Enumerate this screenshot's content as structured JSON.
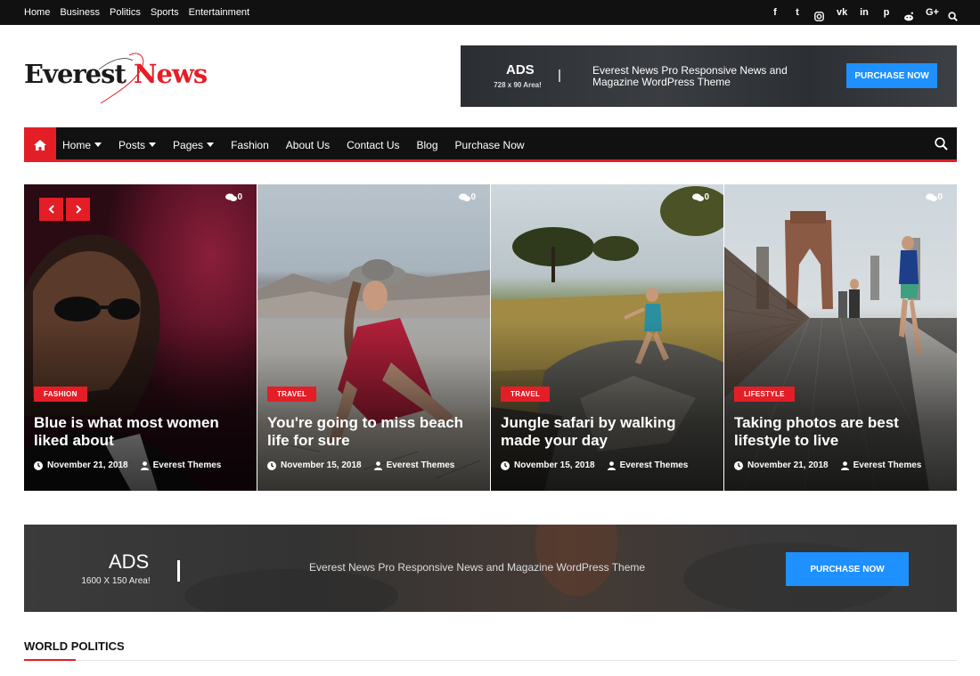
{
  "topbar": {
    "links": [
      "Home",
      "Business",
      "Politics",
      "Sports",
      "Entertainment"
    ],
    "social_icons": [
      "facebook-icon",
      "twitter-icon",
      "instagram-icon",
      "vk-icon",
      "linkedin-icon",
      "pinterest-icon",
      "reddit-icon",
      "google-plus-icon",
      "search-icon"
    ],
    "social_glyphs": [
      "f",
      "t",
      "",
      "vk",
      "in",
      "p",
      "",
      "G+",
      ""
    ]
  },
  "logo": {
    "part1": "Everest",
    "part2": "News"
  },
  "ads_top": {
    "title": "ADS",
    "subtitle": "728 x 90 Area!",
    "text": "Everest News Pro Responsive News and Magazine WordPress Theme",
    "button": "PURCHASE NOW"
  },
  "mainnav": {
    "items": [
      {
        "label": "Home",
        "dropdown": true
      },
      {
        "label": "Posts",
        "dropdown": true
      },
      {
        "label": "Pages",
        "dropdown": true
      },
      {
        "label": "Fashion",
        "dropdown": false
      },
      {
        "label": "About Us",
        "dropdown": false
      },
      {
        "label": "Contact Us",
        "dropdown": false
      },
      {
        "label": "Blog",
        "dropdown": false
      },
      {
        "label": "Purchase Now",
        "dropdown": false
      }
    ]
  },
  "slider": {
    "cards": [
      {
        "category": "FASHION",
        "title": "Blue is what most women liked about",
        "date": "November 21, 2018",
        "author": "Everest Themes",
        "comments": "0"
      },
      {
        "category": "TRAVEL",
        "title": "You're going to miss beach life for sure",
        "date": "November 15, 2018",
        "author": "Everest Themes",
        "comments": "0"
      },
      {
        "category": "TRAVEL",
        "title": "Jungle safari by walking made your day",
        "date": "November 15, 2018",
        "author": "Everest Themes",
        "comments": "0"
      },
      {
        "category": "LIFESTYLE",
        "title": "Taking photos are best lifestyle to live",
        "date": "November 21, 2018",
        "author": "Everest Themes",
        "comments": "0"
      }
    ]
  },
  "ads_big": {
    "title": "ADS",
    "subtitle": "1600 X 150 Area!",
    "text": "Everest News Pro Responsive News and Magazine WordPress Theme",
    "button": "PURCHASE NOW"
  },
  "section": {
    "title": "WORLD POLITICS"
  },
  "colors": {
    "accent": "#e41e26",
    "dark": "#111111",
    "button_blue": "#1e90ff"
  }
}
